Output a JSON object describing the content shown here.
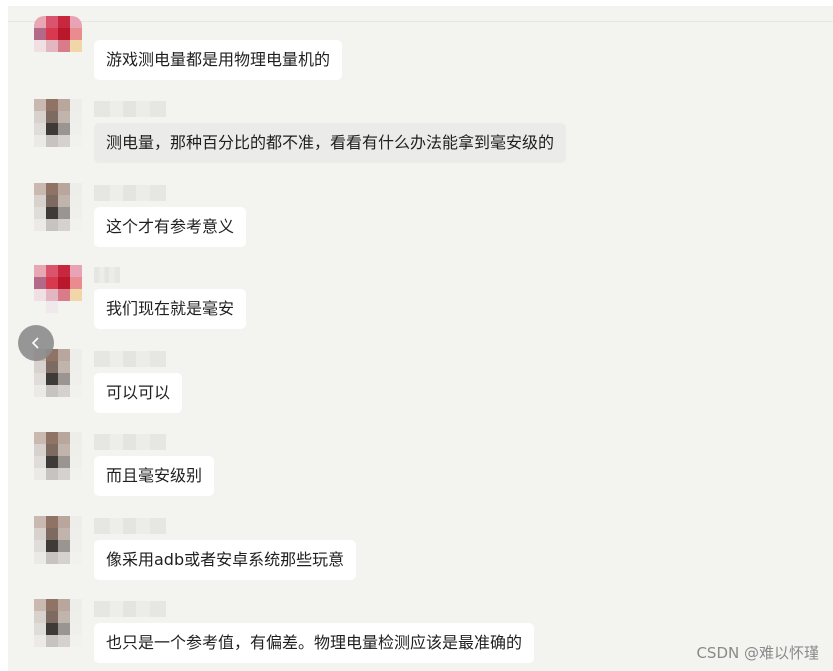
{
  "colors": {
    "panel_bg": "#f3f3f0",
    "bubble_bg": "#ffffff",
    "bubble_hover_bg": "#ebebea",
    "text": "#1f1f1f",
    "nav_button": "#8d8d8d"
  },
  "navigation": {
    "prev_icon": "chevron-left-icon"
  },
  "messages": [
    {
      "text": "游戏测电量都是用物理电量机的"
    },
    {
      "text": "测电量，那种百分比的都不准，看看有什么办法能拿到毫安级的"
    },
    {
      "text": "这个才有参考意义"
    },
    {
      "text": "我们现在就是毫安"
    },
    {
      "text": "可以可以"
    },
    {
      "text": "而且毫安级别"
    },
    {
      "text": "像采用adb或者安卓系统那些玩意"
    },
    {
      "text": "也只是一个参考值，有偏差。物理电量检测应该是最准确的"
    }
  ],
  "watermark": "CSDN @难以怀瑾"
}
